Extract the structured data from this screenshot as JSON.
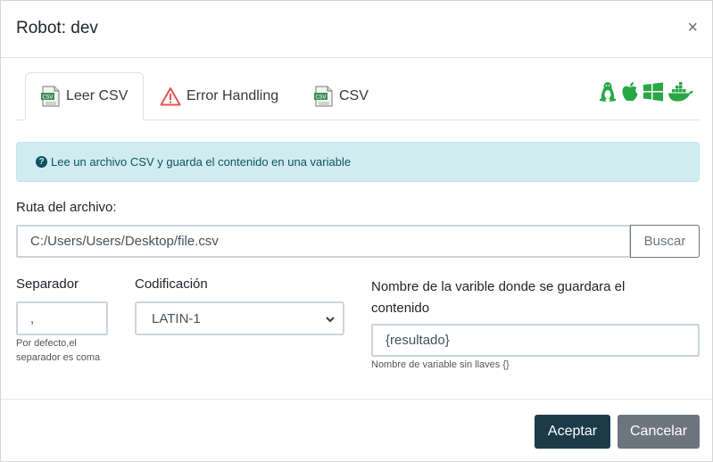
{
  "modal": {
    "title": "Robot: dev",
    "close_symbol": "×"
  },
  "tabs": [
    {
      "label": "Leer CSV",
      "icon": "csv-file-icon",
      "active": true
    },
    {
      "label": "Error Handling",
      "icon": "warning-icon",
      "active": false
    },
    {
      "label": "CSV",
      "icon": "csv-file-icon",
      "active": false
    }
  ],
  "csv_icon_text": "CSV",
  "os_icons": [
    "linux-icon",
    "apple-icon",
    "windows-icon",
    "docker-icon"
  ],
  "colors": {
    "os_icon": "#28a745",
    "alert_bg": "#d1ecf1",
    "accept": "#1c3a4a",
    "cancel": "#6c757d",
    "warning": "#e55353"
  },
  "alert": {
    "icon": "question-circle-icon",
    "text": "Lee un archivo CSV y guarda el contenido en una variable"
  },
  "form": {
    "path_label": "Ruta del archivo:",
    "path_value": "C:/Users/Users/Desktop/file.csv",
    "browse_label": "Buscar",
    "separator_label": "Separador",
    "separator_value": ",",
    "separator_help_1": "Por defecto,el",
    "separator_help_2": "separador es coma",
    "encoding_label": "Codificación",
    "encoding_value": "LATIN-1",
    "var_label_1": "Nombre de la varible donde se guardara el",
    "var_label_2": "contenido",
    "var_value": "{resultado}",
    "var_help": "Nombre de variable sin llaves {}"
  },
  "footer": {
    "accept_label": "Aceptar",
    "cancel_label": "Cancelar"
  }
}
